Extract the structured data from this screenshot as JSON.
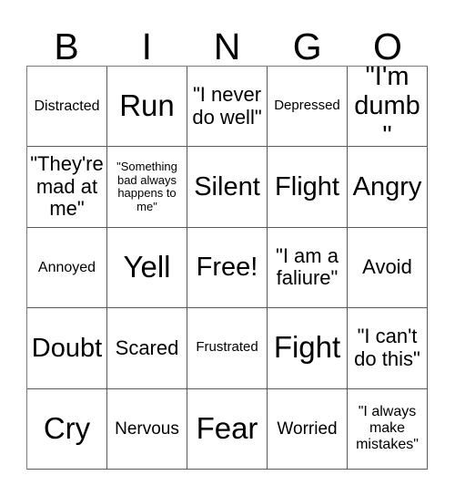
{
  "card": {
    "header_letters": [
      "B",
      "I",
      "N",
      "G",
      "O"
    ],
    "grid": {
      "columns": 5,
      "rows": 5,
      "cells": [
        {
          "text": "Distracted",
          "size": "fs-xs"
        },
        {
          "text": "Run",
          "size": "fs-xl"
        },
        {
          "text": "\"I never do well\"",
          "size": "fs-md"
        },
        {
          "text": "Depressed",
          "size": "fs-xxs"
        },
        {
          "text": "\"I'm dumb\"",
          "size": "fs-lg"
        },
        {
          "text": "\"They're mad at me\"",
          "size": "fs-md"
        },
        {
          "text": "\"Something bad always happens to me\"",
          "size": "fs-tiny"
        },
        {
          "text": "Silent",
          "size": "fs-lg"
        },
        {
          "text": "Flight",
          "size": "fs-lg"
        },
        {
          "text": "Angry",
          "size": "fs-lg"
        },
        {
          "text": "Annoyed",
          "size": "fs-xs"
        },
        {
          "text": "Yell",
          "size": "fs-xl"
        },
        {
          "text": "Free!",
          "size": "fs-lg"
        },
        {
          "text": "\"I am a faliure\"",
          "size": "fs-md"
        },
        {
          "text": "Avoid",
          "size": "fs-md"
        },
        {
          "text": "Doubt",
          "size": "fs-lg"
        },
        {
          "text": "Scared",
          "size": "fs-md"
        },
        {
          "text": "Frustrated",
          "size": "fs-xxs"
        },
        {
          "text": "Fight",
          "size": "fs-xl"
        },
        {
          "text": "\"I can't do this\"",
          "size": "fs-md"
        },
        {
          "text": "Cry",
          "size": "fs-xl"
        },
        {
          "text": "Nervous",
          "size": "fs-sm"
        },
        {
          "text": "Fear",
          "size": "fs-xl"
        },
        {
          "text": "Worried",
          "size": "fs-sm"
        },
        {
          "text": "\"I always make mistakes\"",
          "size": "fs-xs"
        }
      ]
    },
    "colors": {
      "background": "#ffffff",
      "text": "#000000",
      "grid_line": "#5a5a5a"
    }
  }
}
